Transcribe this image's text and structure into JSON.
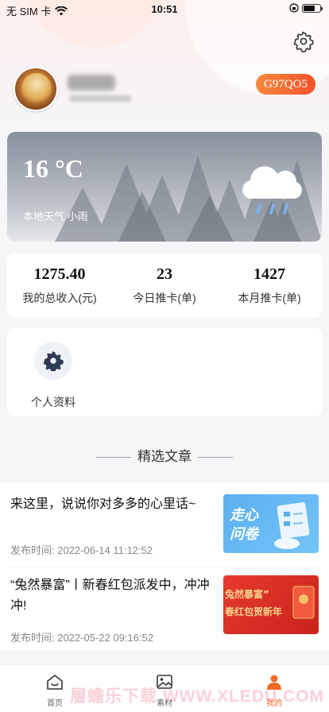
{
  "status_bar": {
    "carrier": "无 SIM 卡",
    "time": "10:51"
  },
  "profile": {
    "code": "G97QO5"
  },
  "weather": {
    "temperature": "16 °C",
    "description": "本地天气 小雨",
    "icon": "cloud-rain-icon"
  },
  "stats": [
    {
      "value": "1275.40",
      "label": "我的总收入(元)"
    },
    {
      "value": "23",
      "label": "今日推卡(单)"
    },
    {
      "value": "1427",
      "label": "本月推卡(单)"
    }
  ],
  "tools": [
    {
      "label": "个人资料",
      "icon": "gear-icon"
    }
  ],
  "section": {
    "title": "精选文章"
  },
  "articles": [
    {
      "title": "来这里，说说你对多多的心里话~",
      "date": "发布时间: 2022-06-14 11:12:52",
      "thumb_text": [
        "走心",
        "问卷"
      ]
    },
    {
      "title": "“兔然暴富”丨新春红包派发中，冲冲冲!",
      "date": "发布时间: 2022-05-22 09:16:52",
      "thumb_text": [
        "兔然暴富”",
        "春红包贺新年"
      ]
    }
  ],
  "tabbar": [
    {
      "label": "首页",
      "icon": "home-icon",
      "active": false
    },
    {
      "label": "素材",
      "icon": "image-icon",
      "active": false
    },
    {
      "label": "我的",
      "icon": "user-icon",
      "active": true
    }
  ],
  "watermark": "層蟾乐下载 WWW.XLEDU.COM",
  "colors": {
    "accent": "#f06a2a",
    "badge_start": "#f78a3d",
    "badge_end": "#f2522a"
  }
}
